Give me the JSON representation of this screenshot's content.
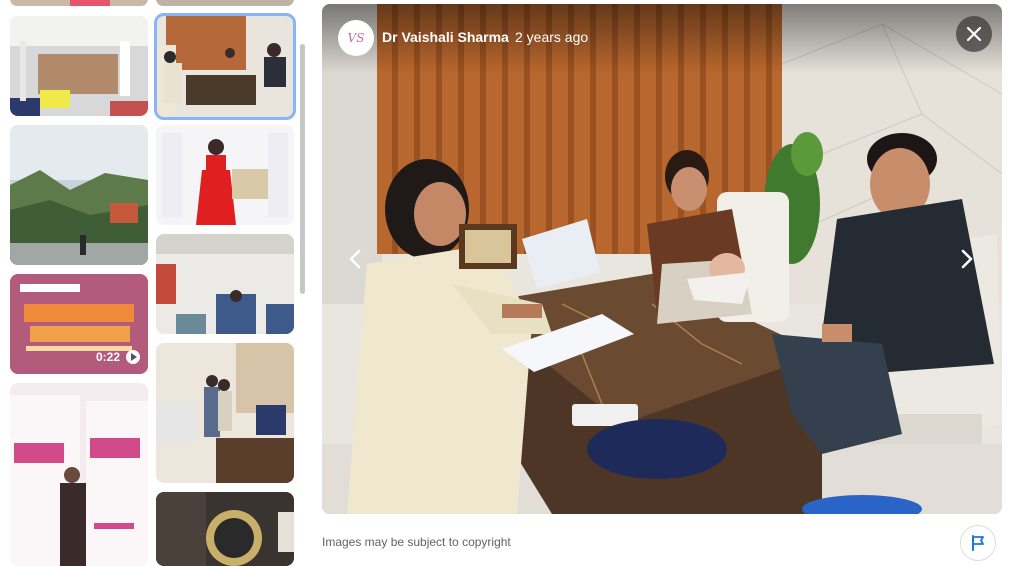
{
  "viewer": {
    "source_name": "Dr Vaishali Sharma",
    "source_separator": "·",
    "age": "2 years ago",
    "logo_text": "VS"
  },
  "thumbnails": {
    "video_duration": "0:22"
  },
  "footer": {
    "copyright_note": "Images may be subject to copyright"
  },
  "icons": {
    "close": "close-icon",
    "prev": "chevron-left-icon",
    "next": "chevron-right-icon",
    "flag": "flag-icon",
    "play": "play-icon"
  },
  "colors": {
    "selected_outline": "#8ab4f8",
    "close_bg": "#3c3c3c",
    "muted_text": "#5f6368",
    "flag_icon": "#1a73e8"
  }
}
